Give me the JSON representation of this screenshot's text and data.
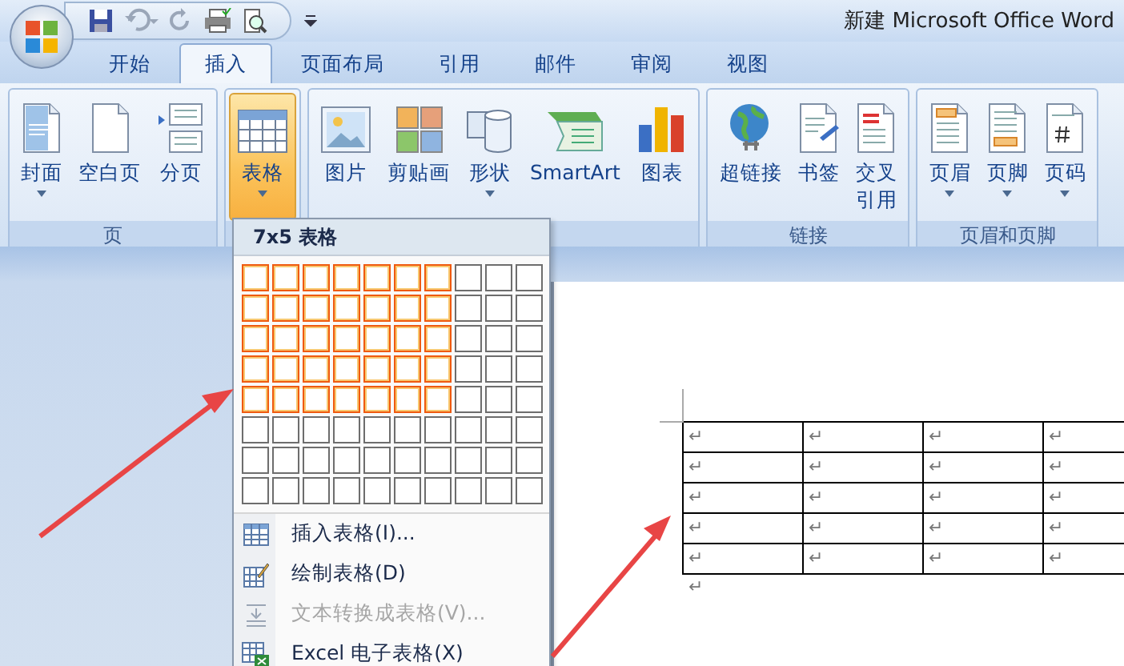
{
  "window": {
    "title": "新建 Microsoft Office Word"
  },
  "tabs": [
    {
      "label": "开始",
      "selected": false
    },
    {
      "label": "插入",
      "selected": true
    },
    {
      "label": "页面布局",
      "selected": false
    },
    {
      "label": "引用",
      "selected": false
    },
    {
      "label": "邮件",
      "selected": false
    },
    {
      "label": "审阅",
      "selected": false
    },
    {
      "label": "视图",
      "selected": false
    }
  ],
  "ribbon_groups": [
    {
      "label": "页",
      "buttons": [
        {
          "label": "封面",
          "dropdown": true,
          "selected": false
        },
        {
          "label": "空白页",
          "dropdown": false,
          "selected": false
        },
        {
          "label": "分页",
          "dropdown": false,
          "selected": false
        }
      ]
    },
    {
      "buttons": [
        {
          "label": "表格",
          "dropdown": true,
          "selected": true
        }
      ]
    },
    {
      "buttons": [
        {
          "label": "图片",
          "dropdown": false,
          "selected": false
        },
        {
          "label": "剪贴画",
          "dropdown": false,
          "selected": false
        },
        {
          "label": "形状",
          "dropdown": true,
          "selected": false
        },
        {
          "label": "SmartArt",
          "dropdown": false,
          "selected": false
        },
        {
          "label": "图表",
          "dropdown": false,
          "selected": false
        }
      ]
    },
    {
      "label": "链接",
      "buttons": [
        {
          "label": "超链接",
          "dropdown": false,
          "selected": false
        },
        {
          "label": "书签",
          "dropdown": false,
          "selected": false
        },
        {
          "label": "交叉",
          "label_line2": "引用",
          "dropdown": false,
          "selected": false
        }
      ]
    },
    {
      "label": "页眉和页脚",
      "buttons": [
        {
          "label": "页眉",
          "dropdown": true,
          "selected": false
        },
        {
          "label": "页脚",
          "dropdown": true,
          "selected": false
        },
        {
          "label": "页码",
          "dropdown": true,
          "selected": false
        }
      ]
    }
  ],
  "table_menu": {
    "title": "7x5 表格",
    "grid": [
      {
        "cells": [
          {
            "highlighted": true
          },
          {
            "highlighted": true
          },
          {
            "highlighted": true
          },
          {
            "highlighted": true
          },
          {
            "highlighted": true
          },
          {
            "highlighted": true
          },
          {
            "highlighted": true
          },
          {
            "highlighted": false
          },
          {
            "highlighted": false
          },
          {
            "highlighted": false
          }
        ]
      },
      {
        "cells": [
          {
            "highlighted": true
          },
          {
            "highlighted": true
          },
          {
            "highlighted": true
          },
          {
            "highlighted": true
          },
          {
            "highlighted": true
          },
          {
            "highlighted": true
          },
          {
            "highlighted": true
          },
          {
            "highlighted": false
          },
          {
            "highlighted": false
          },
          {
            "highlighted": false
          }
        ]
      },
      {
        "cells": [
          {
            "highlighted": true
          },
          {
            "highlighted": true
          },
          {
            "highlighted": true
          },
          {
            "highlighted": true
          },
          {
            "highlighted": true
          },
          {
            "highlighted": true
          },
          {
            "highlighted": true
          },
          {
            "highlighted": false
          },
          {
            "highlighted": false
          },
          {
            "highlighted": false
          }
        ]
      },
      {
        "cells": [
          {
            "highlighted": true
          },
          {
            "highlighted": true
          },
          {
            "highlighted": true
          },
          {
            "highlighted": true
          },
          {
            "highlighted": true
          },
          {
            "highlighted": true
          },
          {
            "highlighted": true
          },
          {
            "highlighted": false
          },
          {
            "highlighted": false
          },
          {
            "highlighted": false
          }
        ]
      },
      {
        "cells": [
          {
            "highlighted": true
          },
          {
            "highlighted": true
          },
          {
            "highlighted": true
          },
          {
            "highlighted": true
          },
          {
            "highlighted": true
          },
          {
            "highlighted": true
          },
          {
            "highlighted": true
          },
          {
            "highlighted": false
          },
          {
            "highlighted": false
          },
          {
            "highlighted": false
          }
        ]
      },
      {
        "cells": [
          {
            "highlighted": false
          },
          {
            "highlighted": false
          },
          {
            "highlighted": false
          },
          {
            "highlighted": false
          },
          {
            "highlighted": false
          },
          {
            "highlighted": false
          },
          {
            "highlighted": false
          },
          {
            "highlighted": false
          },
          {
            "highlighted": false
          },
          {
            "highlighted": false
          }
        ]
      },
      {
        "cells": [
          {
            "highlighted": false
          },
          {
            "highlighted": false
          },
          {
            "highlighted": false
          },
          {
            "highlighted": false
          },
          {
            "highlighted": false
          },
          {
            "highlighted": false
          },
          {
            "highlighted": false
          },
          {
            "highlighted": false
          },
          {
            "highlighted": false
          },
          {
            "highlighted": false
          }
        ]
      },
      {
        "cells": [
          {
            "highlighted": false
          },
          {
            "highlighted": false
          },
          {
            "highlighted": false
          },
          {
            "highlighted": false
          },
          {
            "highlighted": false
          },
          {
            "highlighted": false
          },
          {
            "highlighted": false
          },
          {
            "highlighted": false
          },
          {
            "highlighted": false
          },
          {
            "highlighted": false
          }
        ]
      }
    ],
    "items": [
      {
        "label": "插入表格(I)...",
        "disabled": false
      },
      {
        "label": "绘制表格(D)",
        "disabled": false
      },
      {
        "label": "文本转换成表格(V)...",
        "disabled": true
      },
      {
        "label": "Excel 电子表格(X)",
        "disabled": false
      }
    ]
  },
  "document": {
    "table": {
      "rows": [
        {
          "cells": [
            "↵",
            "↵",
            "↵",
            "↵"
          ]
        },
        {
          "cells": [
            "↵",
            "↵",
            "↵",
            "↵"
          ]
        },
        {
          "cells": [
            "↵",
            "↵",
            "↵",
            "↵"
          ]
        },
        {
          "cells": [
            "↵",
            "↵",
            "↵",
            "↵"
          ]
        },
        {
          "cells": [
            "↵",
            "↵",
            "↵",
            "↵"
          ]
        }
      ]
    },
    "paragraph_mark": "↵"
  }
}
